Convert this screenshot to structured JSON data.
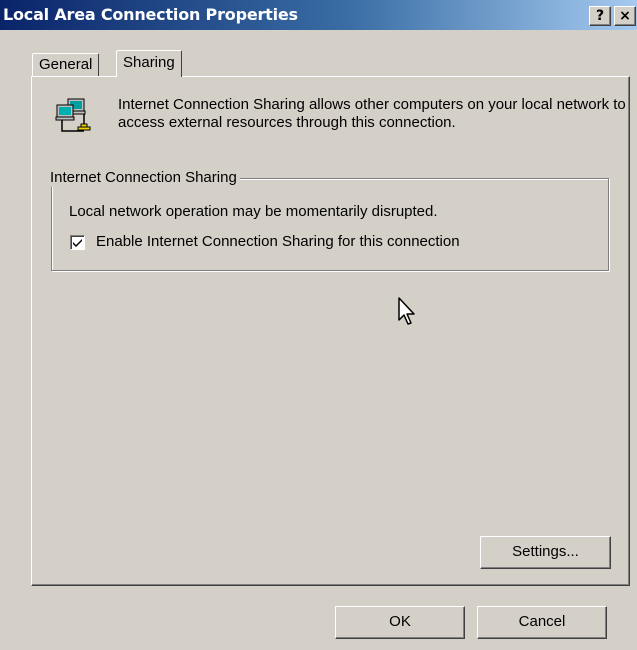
{
  "window": {
    "title": "Local Area Connection Properties",
    "help_button": "?",
    "close_button": "×"
  },
  "tabs": [
    {
      "label": "General",
      "selected": false
    },
    {
      "label": "Sharing",
      "selected": true
    }
  ],
  "sharing": {
    "intro_text": "Internet Connection Sharing allows other computers on your local network to access external resources through this connection.",
    "group_title": "Internet Connection Sharing",
    "group_description": "Local network operation may be momentarily disrupted.",
    "enable_checkbox": {
      "label": "Enable Internet Connection Sharing for this connection",
      "checked": true
    },
    "settings_button": "Settings..."
  },
  "footer": {
    "ok_label": "OK",
    "cancel_label": "Cancel"
  },
  "icons": {
    "network": "network-computers-icon",
    "cursor": "mouse-pointer-icon"
  }
}
